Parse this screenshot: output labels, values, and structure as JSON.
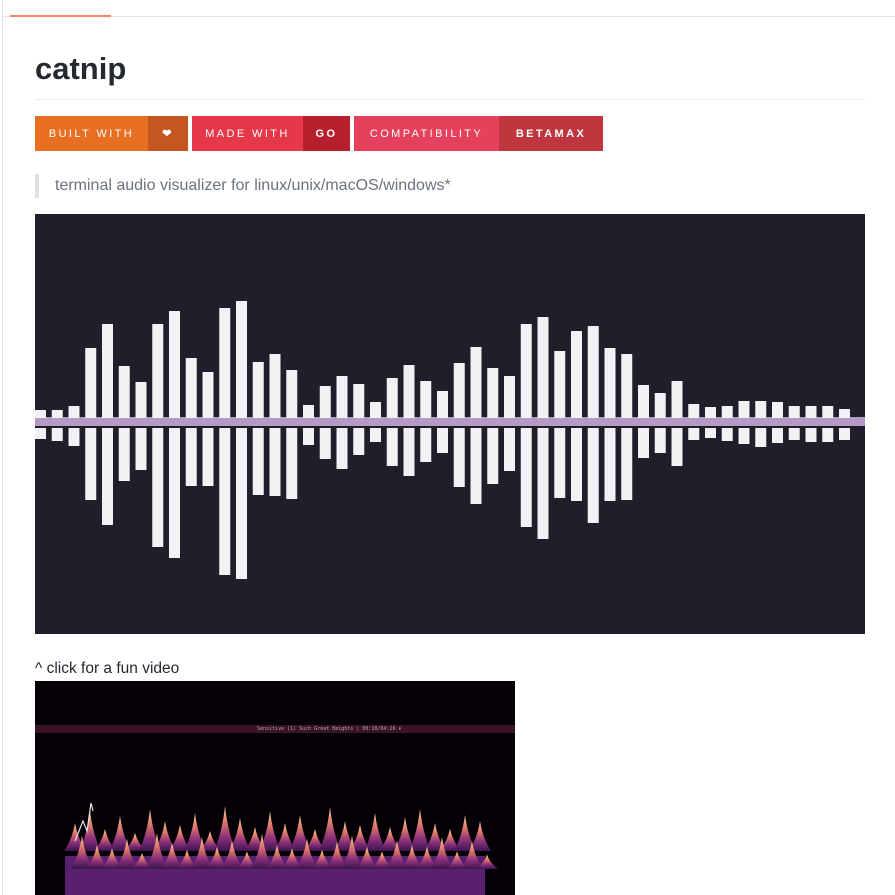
{
  "repo": {
    "title": "catnip",
    "description": "terminal audio visualizer for linux/unix/macOS/windows*",
    "video_caption": "^ click for a fun video"
  },
  "badges": [
    {
      "left": "BUILT WITH",
      "right_icon": "heart-icon"
    },
    {
      "left": "MADE WITH",
      "right": "GO"
    },
    {
      "left": "COMPATIBILITY",
      "right": "BETAMAX"
    }
  ],
  "colors": {
    "accent_tab": "#f9826c",
    "visualizer_bg": "#201e2b",
    "bar_color": "#f3f1f3",
    "center_line": "#b39bc6"
  },
  "visualizer": {
    "bars_up": [
      8,
      8,
      12,
      70,
      94,
      52,
      36,
      94,
      107,
      60,
      46,
      110,
      117,
      56,
      64,
      48,
      13,
      32,
      42,
      34,
      16,
      40,
      53,
      37,
      27,
      55,
      71,
      50,
      42,
      94,
      101,
      67,
      87,
      92,
      70,
      64,
      33,
      25,
      37,
      14,
      11,
      12,
      17,
      17,
      16,
      12,
      12,
      12,
      9
    ],
    "bars_down": [
      11,
      13,
      18,
      72,
      97,
      53,
      42,
      119,
      130,
      58,
      58,
      147,
      151,
      67,
      68,
      71,
      17,
      31,
      41,
      27,
      14,
      38,
      48,
      34,
      25,
      59,
      76,
      56,
      43,
      99,
      111,
      70,
      73,
      95,
      73,
      72,
      30,
      25,
      38,
      12,
      10,
      13,
      16,
      19,
      15,
      12,
      14,
      14,
      12
    ]
  },
  "video": {
    "status_text": "Sensitive (1) Such Great Heights | 00:18/04:26   ⏸"
  }
}
